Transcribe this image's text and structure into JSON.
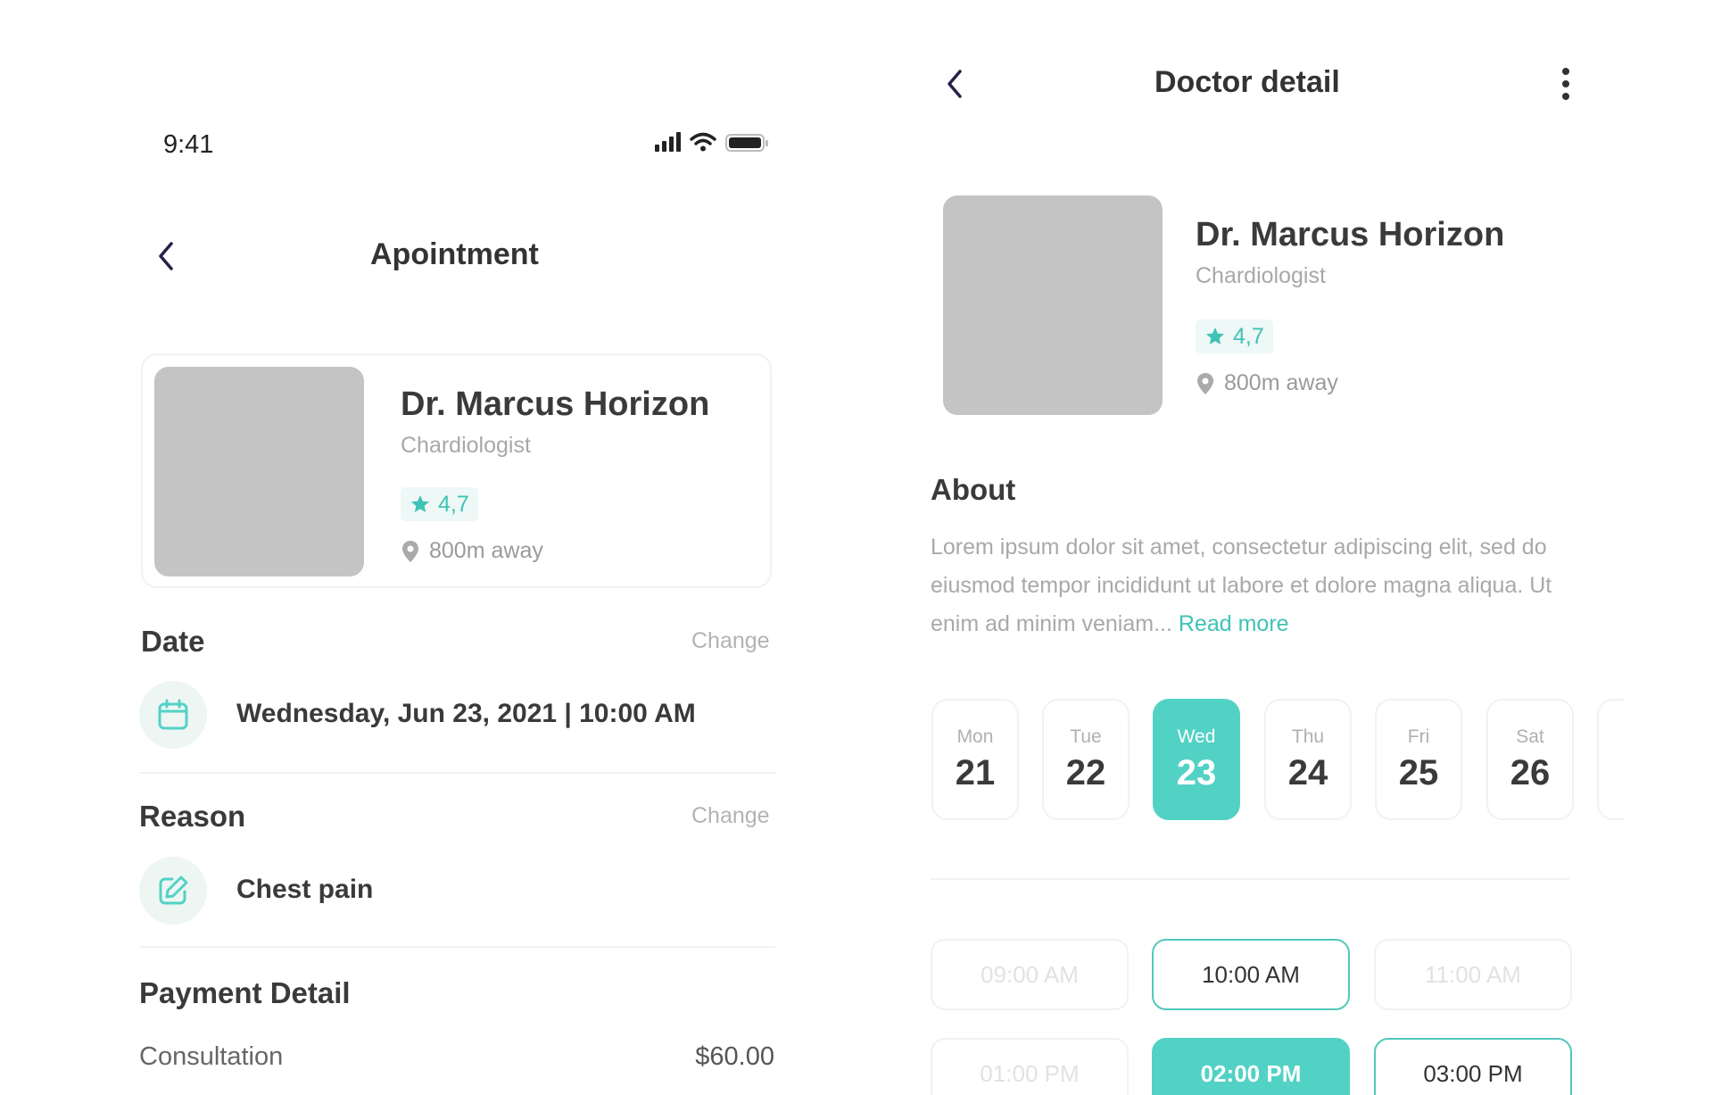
{
  "appointment": {
    "status_time": "9:41",
    "title": "Apointment",
    "doctor": {
      "name": "Dr. Marcus Horizon",
      "specialty": "Chardiologist",
      "rating": "4,7",
      "distance": "800m away"
    },
    "date_section": {
      "title": "Date",
      "change_label": "Change",
      "value": "Wednesday, Jun 23, 2021 | 10:00 AM"
    },
    "reason_section": {
      "title": "Reason",
      "change_label": "Change",
      "value": "Chest pain"
    },
    "payment": {
      "title": "Payment Detail",
      "rows": [
        {
          "label": "Consultation",
          "value": "$60.00"
        }
      ]
    }
  },
  "doctor_detail": {
    "title": "Doctor detail",
    "doctor": {
      "name": "Dr. Marcus Horizon",
      "specialty": "Chardiologist",
      "rating": "4,7",
      "distance": "800m away"
    },
    "about_title": "About",
    "about_text": "Lorem ipsum dolor sit amet, consectetur adipiscing elit, sed do eiusmod tempor incididunt ut labore et dolore magna aliqua. Ut enim ad minim veniam... ",
    "read_more": "Read more",
    "days": [
      {
        "name": "Mon",
        "date": "21",
        "selected": false
      },
      {
        "name": "Tue",
        "date": "22",
        "selected": false
      },
      {
        "name": "Wed",
        "date": "23",
        "selected": true
      },
      {
        "name": "Thu",
        "date": "24",
        "selected": false
      },
      {
        "name": "Fri",
        "date": "25",
        "selected": false
      },
      {
        "name": "Sat",
        "date": "26",
        "selected": false
      }
    ],
    "times": [
      {
        "label": "09:00 AM",
        "state": "disabled"
      },
      {
        "label": "10:00 AM",
        "state": "available"
      },
      {
        "label": "11:00 AM",
        "state": "disabled"
      },
      {
        "label": "01:00 PM",
        "state": "disabled"
      },
      {
        "label": "02:00 PM",
        "state": "selected"
      },
      {
        "label": "03:00 PM",
        "state": "available"
      }
    ]
  },
  "colors": {
    "accent": "#52d2c5",
    "accent_text": "#3fc3b6",
    "placeholder": "#c4c4c4"
  },
  "icons": [
    "chevron-left-icon",
    "signal-icon",
    "wifi-icon",
    "battery-icon",
    "star-icon",
    "location-pin-icon",
    "calendar-icon",
    "edit-icon",
    "more-vertical-icon"
  ]
}
